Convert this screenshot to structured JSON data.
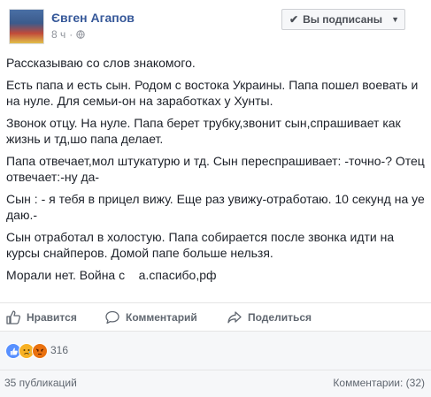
{
  "header": {
    "author": "Євген Агапов",
    "time": "8 ч",
    "time_sep": "·",
    "follow_label": "Вы подписаны"
  },
  "post": {
    "paragraphs": [
      "Рассказываю со слов знакомого.",
      "Есть папа и есть сын. Родом с востока Украины. Папа пошел воевать и на нуле. Для семьи-он на заработках у Хунты.",
      "Звонок отцу. На нуле. Папа берет трубку,звонит сын,спрашивает как жизнь и тд,шо папа делает.",
      "Папа отвечает,мол штукатурю и тд. Сын переспрашивает: -точно-? Отец отвечает:-ну да-",
      "Сын : - я тебя в прицел вижу. Еще раз увижу-отработаю. 10 секунд на уе даю.-",
      "Сын отработал в холостую. Папа собирается после звонка идти на курсы снайперов. Домой папе больше нельзя.",
      "Морали нет. Война с    а.спасибо,рф"
    ]
  },
  "actions": {
    "like": "Нравится",
    "comment": "Комментарий",
    "share": "Поделиться"
  },
  "reactions": {
    "count": "316",
    "types": [
      "like",
      "sad",
      "angry"
    ]
  },
  "footer": {
    "publications": "35 публикаций",
    "comments": "Комментарии: (32)"
  },
  "colors": {
    "link": "#365899",
    "muted": "#606770",
    "like": "#5890ff",
    "sad": "#f7b125",
    "angry": "#e9710f"
  }
}
